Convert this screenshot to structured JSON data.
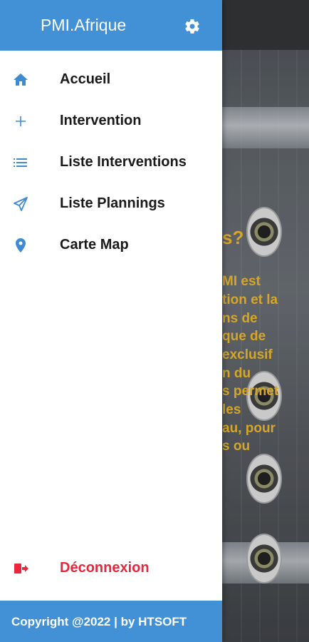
{
  "app": {
    "title": "PMI.Afrique"
  },
  "colors": {
    "header": "#4290d6",
    "accent_icon": "#3f8bd1",
    "logout": "#e8263c",
    "bg_text": "#d4a62a"
  },
  "header": {
    "settings_icon": "gear-icon"
  },
  "menu": [
    {
      "label": "Accueil",
      "icon": "home-icon"
    },
    {
      "label": "Intervention",
      "icon": "plus-icon"
    },
    {
      "label": "Liste Interventions",
      "icon": "list-icon"
    },
    {
      "label": "Liste Plannings",
      "icon": "send-icon"
    },
    {
      "label": "Carte Map",
      "icon": "map-pin-icon"
    }
  ],
  "logout": {
    "label": "Déconnexion",
    "icon": "logout-icon"
  },
  "footer": {
    "copyright": "Copyright @2022 | by HTSOFT"
  },
  "background": {
    "heading": "s?",
    "lines": [
      "MI est",
      "tion et la",
      "ns de",
      "que de",
      "exclusif",
      "n du",
      "s permet",
      "les",
      "au, pour",
      "s ou"
    ]
  }
}
